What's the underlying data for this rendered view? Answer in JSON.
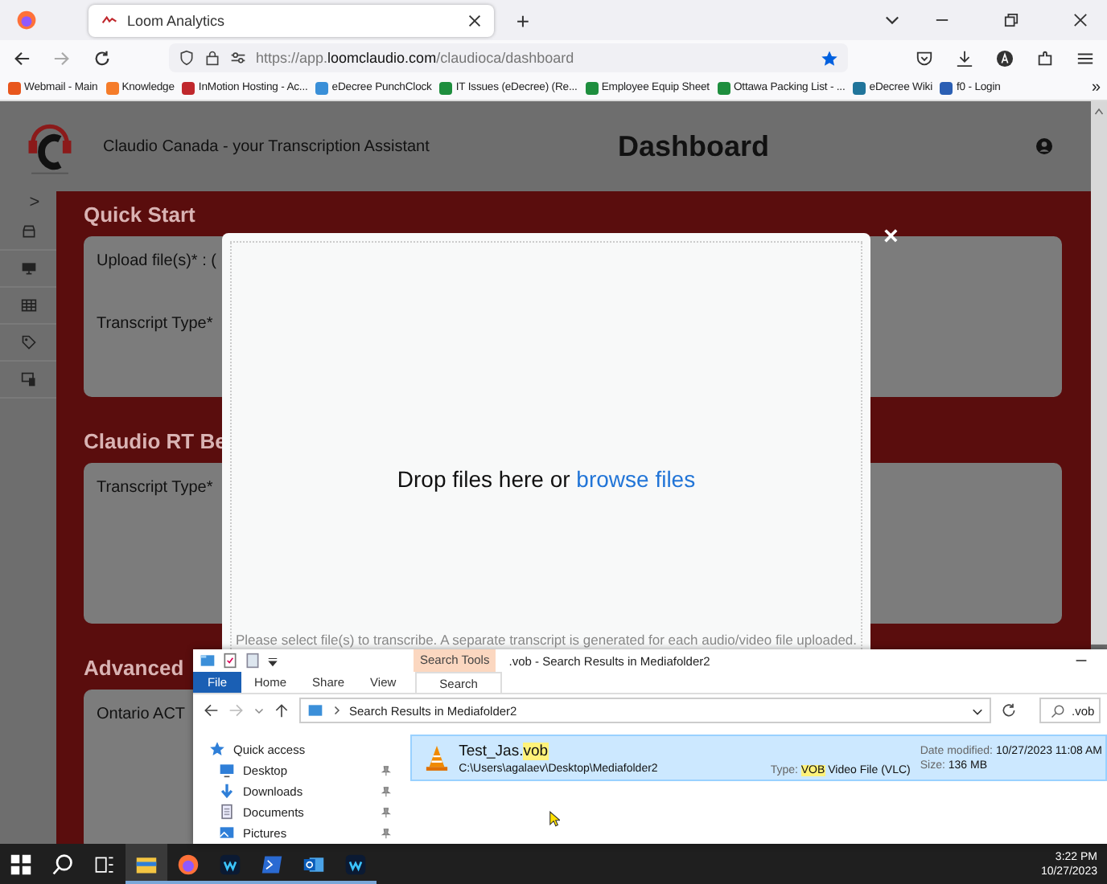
{
  "browser": {
    "tabs": [
      {
        "title": "Loom Analytics",
        "selected": true
      }
    ],
    "new_tab": "+",
    "url": {
      "prefix": "https://app.",
      "host": "loomclaudio.com",
      "path": "/claudioca/dashboard"
    },
    "bookmarks": [
      {
        "label": "Webmail - Main",
        "color": "#e8561c"
      },
      {
        "label": "Knowledge",
        "color": "#f57c2a"
      },
      {
        "label": "InMotion Hosting - Ac...",
        "color": "#c0282d"
      },
      {
        "label": "eDecree PunchClock",
        "color": "#3a8fd8"
      },
      {
        "label": "IT Issues (eDecree) (Re...",
        "color": "#1e8e3e"
      },
      {
        "label": "Employee Equip Sheet",
        "color": "#1e8e3e"
      },
      {
        "label": "Ottawa Packing List - ...",
        "color": "#1e8e3e"
      },
      {
        "label": "eDecree Wiki",
        "color": "#21759b"
      },
      {
        "label": "f0 - Login",
        "color": "#2b5fb4"
      }
    ],
    "more": "»"
  },
  "page": {
    "brand": "Claudio Canada - your Transcription Assistant",
    "title": "Dashboard",
    "expand": ">",
    "sections": [
      {
        "heading": "Quick Start",
        "fields": [
          "Upload file(s)* :  (",
          "Transcript Type*"
        ]
      },
      {
        "heading": "Claudio RT Be",
        "fields": [
          "Transcript Type*"
        ]
      },
      {
        "heading": "Advanced",
        "fields": [
          "Ontario ACT"
        ]
      }
    ]
  },
  "upload_dialog": {
    "close": "×",
    "drop_text": "Drop files here or ",
    "browse_link": "browse files",
    "note": "Please select file(s) to transcribe.  A separate transcript is generated for each audio/video file uploaded."
  },
  "explorer": {
    "context_tab": "Search Tools",
    "title": ".vob - Search Results in Mediafolder2",
    "ribbon_tabs": [
      {
        "label": "File",
        "kind": "file",
        "selected": false
      },
      {
        "label": "Home",
        "kind": "tab",
        "selected": false
      },
      {
        "label": "Share",
        "kind": "tab",
        "selected": false
      },
      {
        "label": "View",
        "kind": "tab",
        "selected": false
      },
      {
        "label": "Search",
        "kind": "tab",
        "selected": true
      }
    ],
    "address": "Search Results in Mediafolder2",
    "search": ".vob",
    "nav": [
      {
        "label": "Quick access",
        "kind": "header",
        "pinned": false
      },
      {
        "label": "Desktop",
        "kind": "desktop",
        "pinned": true
      },
      {
        "label": "Downloads",
        "kind": "downloads",
        "pinned": true
      },
      {
        "label": "Documents",
        "kind": "documents",
        "pinned": true
      },
      {
        "label": "Pictures",
        "kind": "pictures",
        "pinned": true
      }
    ],
    "results": [
      {
        "name_start": "Test_Jas.",
        "name_match": "vob",
        "path": "C:\\Users\\agalaev\\Desktop\\Mediafolder2",
        "type_label": "Type:",
        "type_match": "VOB",
        "type_rest": " Video File (VLC)",
        "date_label": "Date modified:",
        "date": "10/27/2023 11:08 AM",
        "size_label": "Size:",
        "size": "136 MB",
        "selected": true
      }
    ]
  },
  "taskbar": {
    "time": "3:22 PM",
    "date": "10/27/2023"
  }
}
